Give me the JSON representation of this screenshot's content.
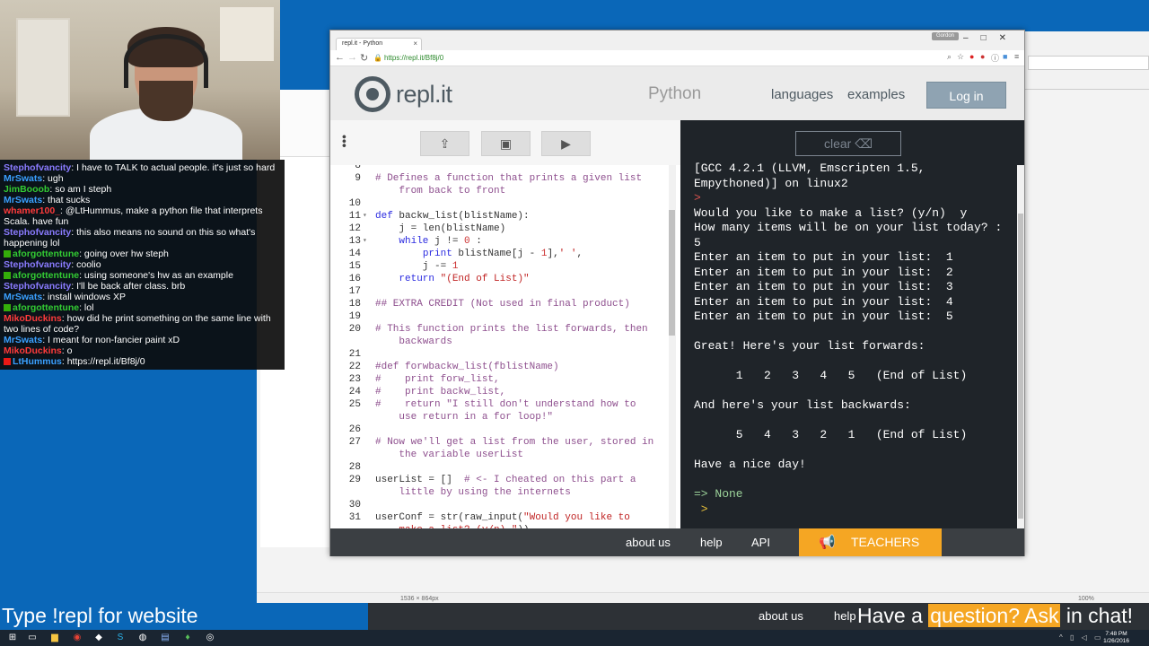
{
  "webcam": {},
  "chat": {
    "lines": [
      {
        "user": "Stephofvancity",
        "user_color": "#8a7bff",
        "badge": "",
        "msg": "I have to TALK to actual people. it's just so hard"
      },
      {
        "user": "MrSwats",
        "user_color": "#3aa0ff",
        "badge": "",
        "msg": "ugh"
      },
      {
        "user": "JimBooob",
        "user_color": "#33cc33",
        "badge": "",
        "msg": "so am I steph"
      },
      {
        "user": "MrSwats",
        "user_color": "#3aa0ff",
        "badge": "",
        "msg": "that sucks"
      },
      {
        "user": "whamer100_",
        "user_color": "#ff3b3b",
        "badge": "",
        "msg": "@LtHummus, make a python file that interprets Scala. have fun"
      },
      {
        "user": "Stephofvancity",
        "user_color": "#8a7bff",
        "badge": "",
        "msg": "this also means no sound on this so what's happening lol"
      },
      {
        "user": "aforgottentune",
        "user_color": "#33cc33",
        "badge": "mod",
        "msg": "going over hw steph"
      },
      {
        "user": "Stephofvancity",
        "user_color": "#8a7bff",
        "badge": "",
        "msg": "coolio"
      },
      {
        "user": "aforgottentune",
        "user_color": "#33cc33",
        "badge": "mod",
        "msg": "using someone's hw as an example"
      },
      {
        "user": "Stephofvancity",
        "user_color": "#8a7bff",
        "badge": "",
        "msg": "I'll be back after class. brb"
      },
      {
        "user": "MrSwats",
        "user_color": "#3aa0ff",
        "badge": "",
        "msg": "install windows XP"
      },
      {
        "user": "aforgottentune",
        "user_color": "#33cc33",
        "badge": "mod",
        "msg": "lol"
      },
      {
        "user": "MikoDuckins",
        "user_color": "#ff3b3b",
        "badge": "",
        "msg": "how did he print something on the same line with two lines of code?"
      },
      {
        "user": "MrSwats",
        "user_color": "#3aa0ff",
        "badge": "",
        "msg": "I meant for non-fancier paint xD"
      },
      {
        "user": "MikoDuckins",
        "user_color": "#ff3b3b",
        "badge": "",
        "msg": "o"
      },
      {
        "user": "LtHummus",
        "user_color": "#3aa0ff",
        "badge": "broadcaster",
        "msg": "https://repl.it/Bf8j/0"
      }
    ]
  },
  "browser": {
    "tab_title": "repl.it - Python",
    "url": "https://repl.it/Bf8j/0",
    "profile": "Gordon"
  },
  "repl": {
    "logo": "repl.it",
    "language": "Python",
    "nav_languages": "languages",
    "nav_examples": "examples",
    "login": "Log in",
    "clear": "clear",
    "footer_about": "about us",
    "footer_help": "help",
    "footer_api": "API",
    "teachers": "TEACHERS"
  },
  "editor": {
    "lines": [
      {
        "n": "8",
        "fold": "",
        "html": ""
      },
      {
        "n": "9",
        "fold": "",
        "html": "<span class='cm'># Defines a function that prints a given list</span>"
      },
      {
        "n": "",
        "fold": "",
        "html": "<span class='cm'>    from back to front</span>"
      },
      {
        "n": "10",
        "fold": "",
        "html": ""
      },
      {
        "n": "11",
        "fold": "▾",
        "html": "<span class='kw'>def</span> backw_list(blistName):"
      },
      {
        "n": "12",
        "fold": "",
        "html": "    j = len(blistName)"
      },
      {
        "n": "13",
        "fold": "▾",
        "html": "    <span class='kw'>while</span> j != <span class='num'>0</span> :"
      },
      {
        "n": "14",
        "fold": "",
        "html": "        <span class='kw'>print</span> blistName[j - <span class='num'>1</span>],<span class='str'>' '</span>,"
      },
      {
        "n": "15",
        "fold": "",
        "html": "        j -= <span class='num'>1</span>"
      },
      {
        "n": "16",
        "fold": "",
        "html": "    <span class='kw'>return</span> <span class='str'>\"(End of List)\"</span>"
      },
      {
        "n": "17",
        "fold": "",
        "html": ""
      },
      {
        "n": "18",
        "fold": "",
        "html": "<span class='cm'>## EXTRA CREDIT (Not used in final product)</span>"
      },
      {
        "n": "19",
        "fold": "",
        "html": ""
      },
      {
        "n": "20",
        "fold": "",
        "html": "<span class='cm'># This function prints the list forwards, then</span>"
      },
      {
        "n": "",
        "fold": "",
        "html": "<span class='cm'>    backwards</span>"
      },
      {
        "n": "21",
        "fold": "",
        "html": ""
      },
      {
        "n": "22",
        "fold": "",
        "html": "<span class='cm'>#def forwbackw_list(fblistName)</span>"
      },
      {
        "n": "23",
        "fold": "",
        "html": "<span class='cm'>#    print forw_list,</span>"
      },
      {
        "n": "24",
        "fold": "",
        "html": "<span class='cm'>#    print backw_list,</span>"
      },
      {
        "n": "25",
        "fold": "",
        "html": "<span class='cm'>#    return \"I still don't understand how to</span>"
      },
      {
        "n": "",
        "fold": "",
        "html": "<span class='cm'>    use return in a for loop!\"</span>"
      },
      {
        "n": "26",
        "fold": "",
        "html": ""
      },
      {
        "n": "27",
        "fold": "",
        "html": "<span class='cm'># Now we'll get a list from the user, stored in</span>"
      },
      {
        "n": "",
        "fold": "",
        "html": "<span class='cm'>    the variable userList</span>"
      },
      {
        "n": "28",
        "fold": "",
        "html": ""
      },
      {
        "n": "29",
        "fold": "",
        "html": "userList = []  <span class='cm'># <- I cheated on this part a</span>"
      },
      {
        "n": "",
        "fold": "",
        "html": "<span class='cm'>    little by using the internets</span>"
      },
      {
        "n": "30",
        "fold": "",
        "html": ""
      },
      {
        "n": "31",
        "fold": "",
        "html": "userConf = str(raw_input(<span class='str'>\"Would you like to</span>"
      },
      {
        "n": "",
        "fold": "",
        "html": "<span class='str'>    make a list? (y/n) \"</span>))"
      }
    ]
  },
  "console": {
    "lines": [
      {
        "cls": "",
        "text": "[GCC 4.2.1 (LLVM, Emscripten 1.5,"
      },
      {
        "cls": "",
        "text": "Empythoned)] on linux2"
      },
      {
        "cls": "err",
        "text": ">"
      },
      {
        "cls": "",
        "text": "Would you like to make a list? (y/n)  y"
      },
      {
        "cls": "",
        "text": "How many items will be on your list today? :"
      },
      {
        "cls": "",
        "text": "5"
      },
      {
        "cls": "",
        "text": "Enter an item to put in your list:  1"
      },
      {
        "cls": "",
        "text": "Enter an item to put in your list:  2"
      },
      {
        "cls": "",
        "text": "Enter an item to put in your list:  3"
      },
      {
        "cls": "",
        "text": "Enter an item to put in your list:  4"
      },
      {
        "cls": "",
        "text": "Enter an item to put in your list:  5"
      },
      {
        "cls": "",
        "text": ""
      },
      {
        "cls": "",
        "text": "Great! Here's your list forwards:"
      },
      {
        "cls": "",
        "text": ""
      },
      {
        "cls": "",
        "text": "      1   2   3   4   5   (End of List)"
      },
      {
        "cls": "",
        "text": ""
      },
      {
        "cls": "",
        "text": "And here's your list backwards:"
      },
      {
        "cls": "",
        "text": ""
      },
      {
        "cls": "",
        "text": "      5   4   3   2   1   (End of List)"
      },
      {
        "cls": "",
        "text": ""
      },
      {
        "cls": "",
        "text": "Have a nice day!"
      },
      {
        "cls": "",
        "text": ""
      },
      {
        "cls": "result",
        "text": "=> None"
      },
      {
        "cls": "prompt",
        "text": " >"
      }
    ]
  },
  "overlay": {
    "left_text": "Type !repl for website",
    "about": "about us",
    "help": "help",
    "ask_pre": "Have a ",
    "ask_hl": "question? Ask",
    "ask_post": " in chat!"
  },
  "paint_status": {
    "size": "1536 × 864px",
    "zoom": "100%"
  },
  "taskbar": {
    "time": "7:48 PM",
    "date": "1/26/2016"
  }
}
